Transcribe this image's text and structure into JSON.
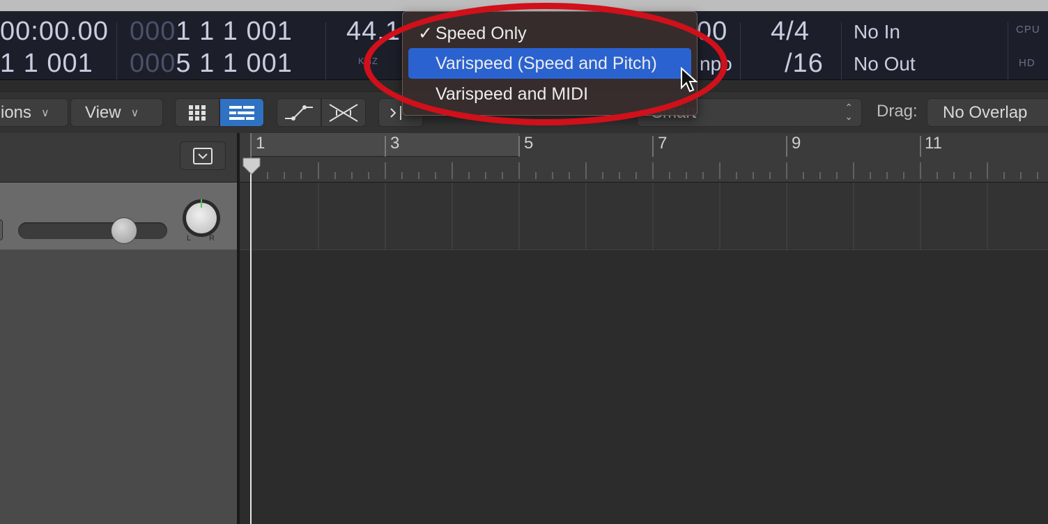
{
  "lcd": {
    "time_top": "00:00.00",
    "time_bottom": "1  1  001",
    "pos_top_dim": "000",
    "pos_top": "1  1  1  001",
    "pos_bottom_dim": "000",
    "pos_bottom": "5  1  1  001",
    "sample_rate": "44.1",
    "sample_unit": "KHZ",
    "tempo_partial": "00",
    "tempo_label_partial": "npo",
    "time_signature": "4/4",
    "division": "/16",
    "in_label": "No In",
    "out_label": "No Out",
    "cpu_label": "CPU",
    "hd_label": "HD"
  },
  "control_bar": {
    "functions_label": "ions",
    "view_label": "View",
    "snap_value": "Smart",
    "drag_label": "Drag:",
    "drag_value": "No Overlap"
  },
  "ruler": {
    "bars": [
      "1",
      "3",
      "5",
      "7",
      "9",
      "11"
    ]
  },
  "track": {
    "pan_left": "L",
    "pan_right": "R"
  },
  "menu": {
    "items": [
      {
        "label": "Speed Only",
        "checked": true,
        "highlighted": false
      },
      {
        "label": "Varispeed (Speed and Pitch)",
        "checked": false,
        "highlighted": true
      },
      {
        "label": "Varispeed and MIDI",
        "checked": false,
        "highlighted": false
      }
    ],
    "check_glyph": "✓"
  },
  "colors": {
    "highlight": "#2a62d0",
    "annotation_ring": "#d0101a",
    "active_segment": "#2f72c4"
  }
}
